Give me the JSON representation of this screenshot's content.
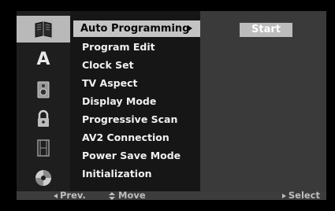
{
  "sidebar": {
    "icons": [
      {
        "name": "general-settings-icon",
        "active": true
      },
      {
        "name": "language-icon",
        "glyph": "A",
        "active": false
      },
      {
        "name": "audio-speaker-icon",
        "active": false
      },
      {
        "name": "lock-icon",
        "active": false
      },
      {
        "name": "recording-film-icon",
        "active": false
      },
      {
        "name": "disc-icon",
        "active": false
      }
    ]
  },
  "menu": {
    "items": [
      {
        "label": "Auto Programming",
        "selected": true
      },
      {
        "label": "Program Edit"
      },
      {
        "label": "Clock Set"
      },
      {
        "label": "TV Aspect"
      },
      {
        "label": "Display Mode"
      },
      {
        "label": "Progressive Scan"
      },
      {
        "label": "AV2 Connection"
      },
      {
        "label": "Power Save Mode"
      },
      {
        "label": "Initialization"
      }
    ]
  },
  "content": {
    "start_label": "Start"
  },
  "footer": {
    "prev_label": "Prev.",
    "move_label": "Move",
    "select_label": "Select"
  }
}
